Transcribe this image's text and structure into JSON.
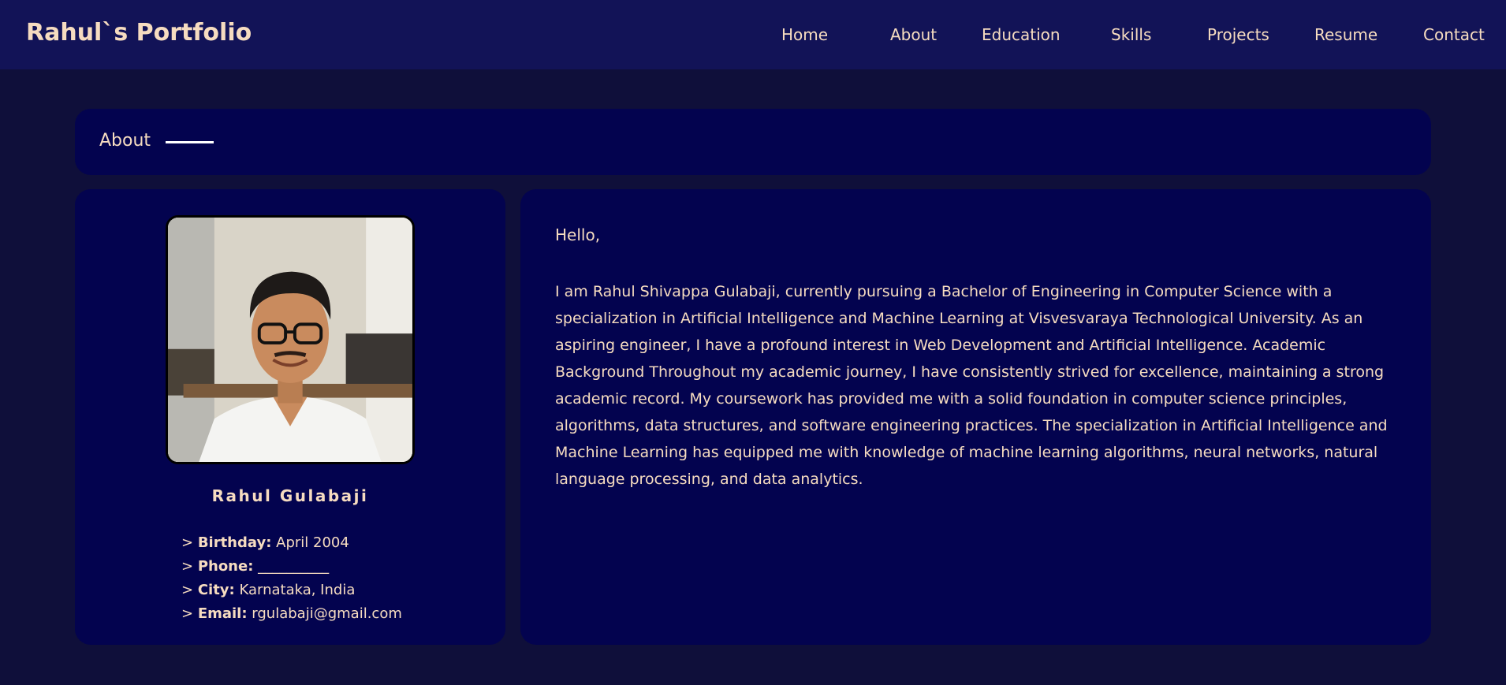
{
  "header": {
    "brand": "Rahul`s Portfolio",
    "nav": [
      {
        "label": "Home"
      },
      {
        "label": "About"
      },
      {
        "label": "Education"
      },
      {
        "label": "Skills"
      },
      {
        "label": "Projects"
      },
      {
        "label": "Resume"
      },
      {
        "label": "Contact"
      }
    ]
  },
  "section": {
    "title": "About"
  },
  "profile": {
    "name": "Rahul Gulabaji",
    "photo_icon": "profile-photo",
    "details": [
      {
        "label": "Birthday:",
        "value": "April 2004"
      },
      {
        "label": "Phone:",
        "value": "__________"
      },
      {
        "label": "City:",
        "value": "Karnataka, India"
      },
      {
        "label": "Email:",
        "value": "rgulabaji@gmail.com"
      }
    ]
  },
  "about": {
    "greeting": "Hello,",
    "bio": "I am Rahul Shivappa Gulabaji, currently pursuing a Bachelor of Engineering in Computer Science with a specialization in Artificial Intelligence and Machine Learning at Visvesvaraya Technological University. As an aspiring engineer, I have a profound interest in Web Development and Artificial Intelligence. Academic Background Throughout my academic journey, I have consistently strived for excellence, maintaining a strong academic record. My coursework has provided me with a solid foundation in computer science principles, algorithms, data structures, and software engineering practices. The specialization in Artificial Intelligence and Machine Learning has equipped me with knowledge of machine learning algorithms, neural networks, natural language processing, and data analytics."
  },
  "colors": {
    "background": "#0f0f3a",
    "navbar": "#121357",
    "card": "#03034f",
    "text": "#f6dcc0"
  }
}
